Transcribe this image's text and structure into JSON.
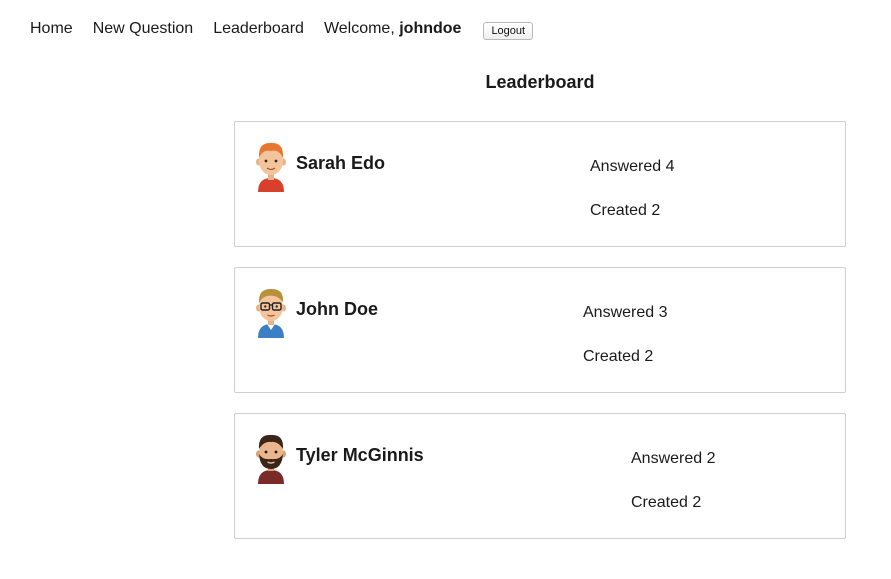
{
  "nav": {
    "home": "Home",
    "new_question": "New Question",
    "leaderboard": "Leaderboard",
    "welcome_prefix": "Welcome, ",
    "username": "johndoe",
    "logout": "Logout"
  },
  "page": {
    "title": "Leaderboard"
  },
  "users": [
    {
      "name": "Sarah Edo",
      "answered": "Answered 4",
      "created": "Created 2",
      "avatar": "avatar-red-hair-icon"
    },
    {
      "name": "John Doe",
      "answered": "Answered 3",
      "created": "Created 2",
      "avatar": "avatar-glasses-icon"
    },
    {
      "name": "Tyler McGinnis",
      "answered": "Answered 2",
      "created": "Created 2",
      "avatar": "avatar-beard-icon"
    }
  ],
  "colors": {
    "card_border": "#cfcfcf",
    "text": "#1a1a1a"
  }
}
